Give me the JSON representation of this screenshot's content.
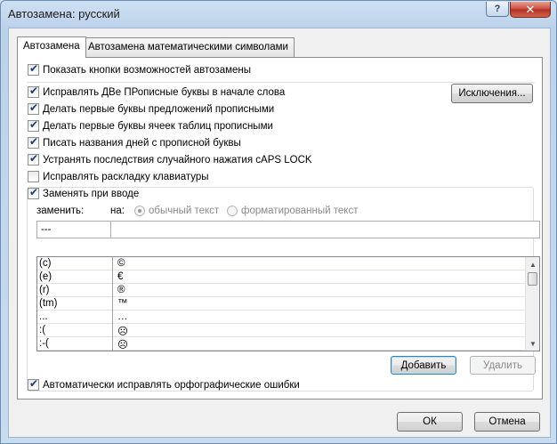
{
  "window": {
    "title": "Автозамена: русский",
    "help_label": "?",
    "close_label": "✕"
  },
  "tabs": [
    {
      "label": "Автозамена",
      "active": true
    },
    {
      "label": "Автозамена математическими символами",
      "active": false
    }
  ],
  "options": {
    "show_buttons": {
      "label": "Показать кнопки возможностей автозамены",
      "checked": true
    },
    "two_caps": {
      "label": "Исправлять ДВе ПРописные буквы в начале слова",
      "checked": true
    },
    "first_sentence": {
      "label": "Делать первые буквы предложений прописными",
      "checked": true
    },
    "first_cell": {
      "label": "Делать первые буквы ячеек таблиц прописными",
      "checked": true
    },
    "day_names": {
      "label": "Писать названия дней с прописной буквы",
      "checked": true
    },
    "caps_lock": {
      "label": "Устранять последствия случайного нажатия cAPS LOCK",
      "checked": true
    },
    "keyboard_layout": {
      "label": "Исправлять раскладку клавиатуры",
      "checked": false
    },
    "replace_as_type": {
      "label": "Заменять при вводе",
      "checked": true
    },
    "auto_spell": {
      "label": "Автоматически исправлять орфографические ошибки",
      "checked": true
    }
  },
  "buttons": {
    "exceptions": "Исключения...",
    "add": "Добавить",
    "delete": "Удалить",
    "ok": "ОК",
    "cancel": "Отмена"
  },
  "replace": {
    "replace_label": "заменить:",
    "with_label": "на:",
    "radio_plain": "обычный текст",
    "radio_formatted": "форматированный текст",
    "replace_value": "---",
    "with_value": ""
  },
  "entries": [
    {
      "from": "(c)",
      "to": "©"
    },
    {
      "from": "(e)",
      "to": "€"
    },
    {
      "from": "(r)",
      "to": "®"
    },
    {
      "from": "(tm)",
      "to": "™"
    },
    {
      "from": "...",
      "to": "…"
    },
    {
      "from": ":(",
      "to": "☹"
    },
    {
      "from": ":-(",
      "to": "☹"
    }
  ]
}
